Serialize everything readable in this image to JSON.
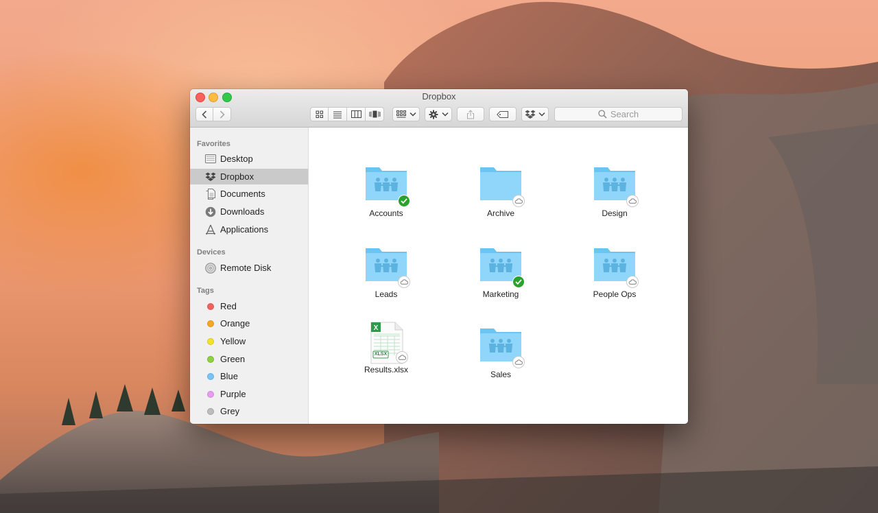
{
  "window": {
    "title": "Dropbox"
  },
  "toolbar": {
    "search_placeholder": "Search"
  },
  "sidebar": {
    "favorites_heading": "Favorites",
    "favorites": [
      {
        "label": "Desktop",
        "icon": "desktop-icon",
        "selected": false
      },
      {
        "label": "Dropbox",
        "icon": "dropbox-icon",
        "selected": true
      },
      {
        "label": "Documents",
        "icon": "documents-icon",
        "selected": false
      },
      {
        "label": "Downloads",
        "icon": "downloads-icon",
        "selected": false
      },
      {
        "label": "Applications",
        "icon": "applications-icon",
        "selected": false
      }
    ],
    "devices_heading": "Devices",
    "devices": [
      {
        "label": "Remote Disk",
        "icon": "disc-icon"
      }
    ],
    "tags_heading": "Tags",
    "tags": [
      {
        "label": "Red",
        "color": "#f1625e"
      },
      {
        "label": "Orange",
        "color": "#f5a623"
      },
      {
        "label": "Yellow",
        "color": "#f3e22a"
      },
      {
        "label": "Green",
        "color": "#8fd13f"
      },
      {
        "label": "Blue",
        "color": "#7cc2f5"
      },
      {
        "label": "Purple",
        "color": "#e79cf0"
      },
      {
        "label": "Grey",
        "color": "#bdbdbd"
      }
    ]
  },
  "files": [
    {
      "name": "Accounts",
      "type": "shared-folder",
      "status": "synced"
    },
    {
      "name": "Archive",
      "type": "folder",
      "status": "cloud"
    },
    {
      "name": "Design",
      "type": "shared-folder",
      "status": "cloud"
    },
    {
      "name": "Leads",
      "type": "shared-folder",
      "status": "cloud"
    },
    {
      "name": "Marketing",
      "type": "shared-folder",
      "status": "synced"
    },
    {
      "name": "People Ops",
      "type": "shared-folder",
      "status": "cloud"
    },
    {
      "name": "Results.xlsx",
      "type": "xlsx",
      "status": "cloud",
      "file_badge": "XLSX"
    },
    {
      "name": "Sales",
      "type": "shared-folder",
      "status": "cloud"
    }
  ],
  "colors": {
    "folder_blue": "#7ccff6",
    "synced_green": "#2aa22e",
    "selection_grey": "#cacaca"
  }
}
